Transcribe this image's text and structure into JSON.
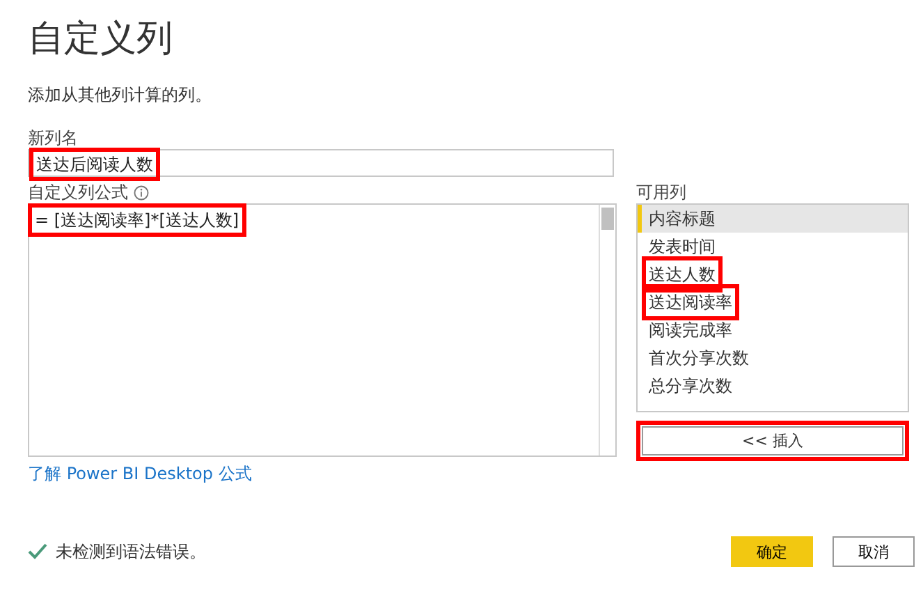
{
  "title": "自定义列",
  "subtitle": "添加从其他列计算的列。",
  "name_field": {
    "label": "新列名",
    "value": "送达后阅读人数",
    "highlighted": true
  },
  "formula_field": {
    "label": "自定义列公式",
    "value": "= [送达阅读率]*[送达人数]",
    "highlighted": true
  },
  "available_columns": {
    "label": "可用列",
    "items": [
      {
        "label": "内容标题",
        "selected": true,
        "highlighted": false
      },
      {
        "label": "发表时间",
        "selected": false,
        "highlighted": false
      },
      {
        "label": "送达人数",
        "selected": false,
        "highlighted": true
      },
      {
        "label": "送达阅读率",
        "selected": false,
        "highlighted": true
      },
      {
        "label": "阅读完成率",
        "selected": false,
        "highlighted": false
      },
      {
        "label": "首次分享次数",
        "selected": false,
        "highlighted": false
      },
      {
        "label": "总分享次数",
        "selected": false,
        "highlighted": false
      }
    ]
  },
  "insert_button": {
    "label": "<< 插入",
    "highlighted": true
  },
  "help_link": "了解 Power BI Desktop 公式",
  "status": "未检测到语法错误。",
  "buttons": [
    {
      "label": "确定",
      "kind": "primary"
    },
    {
      "label": "取消",
      "kind": "secondary"
    }
  ]
}
